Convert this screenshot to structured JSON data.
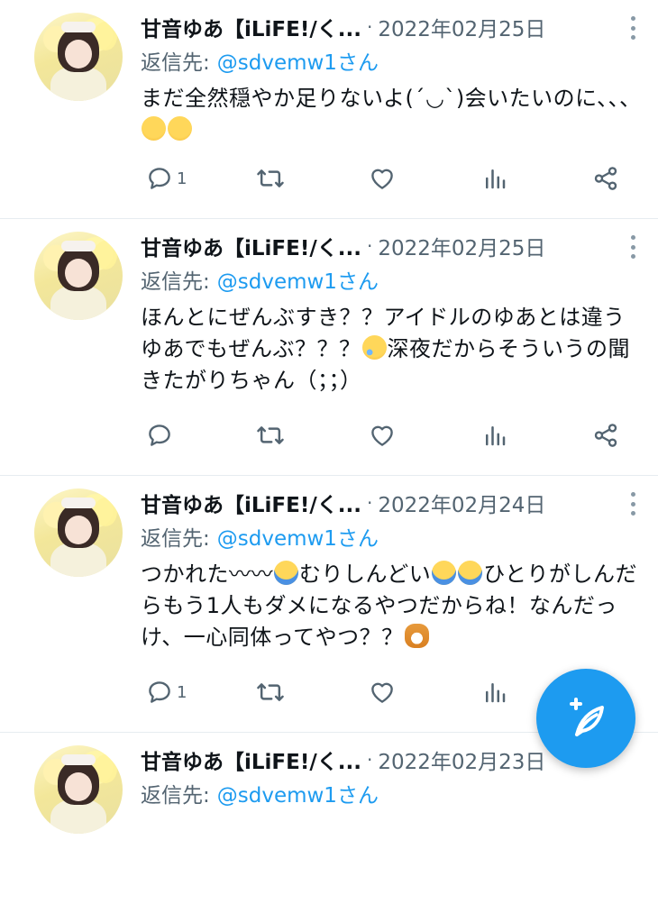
{
  "tweets": [
    {
      "name": "甘音ゆあ【iLiFE!/く...",
      "separator": "·",
      "date": "2022年02月25日",
      "reply_label": "返信先:",
      "reply_handle": "@sdvemw1さん",
      "text_parts": [
        "まだ全然穏やか足りないよ(´◡ˋ)会いたいのに、、、",
        ""
      ],
      "reply_count": "1",
      "emoji": [
        "pensive",
        "pensive"
      ]
    },
    {
      "name": "甘音ゆあ【iLiFE!/く...",
      "separator": "·",
      "date": "2022年02月25日",
      "reply_label": "返信先:",
      "reply_handle": "@sdvemw1さん",
      "text_parts": [
        "ほんとにぜんぶすき？？アイドルのゆあとは違うゆあでもぜんぶ？？？",
        "深夜だからそういうの聞きたがりちゃん（；；）"
      ],
      "reply_count": "",
      "emoji": [
        "tear"
      ]
    },
    {
      "name": "甘音ゆあ【iLiFE!/く...",
      "separator": "·",
      "date": "2022年02月24日",
      "reply_label": "返信先:",
      "reply_handle": "@sdvemw1さん",
      "text_parts": [
        "つかれた〰〰",
        "むりしんどい",
        "ひとりがしんだらもう1人もダメになるやつだからね！なんだっけ、一心同体ってやつ？？",
        ""
      ],
      "reply_count": "1",
      "emoji": [
        "crying",
        "crying",
        "crying",
        "dog"
      ]
    },
    {
      "name": "甘音ゆあ【iLiFE!/く...",
      "separator": "·",
      "date": "2022年02月23日",
      "reply_label": "返信先:",
      "reply_handle": "@sdvemw1さん"
    }
  ],
  "icons": {
    "reply": "reply-icon",
    "retweet": "retweet-icon",
    "like": "heart-icon",
    "analytics": "analytics-icon",
    "share": "share-icon",
    "more": "more-icon",
    "compose": "compose-icon"
  },
  "colors": {
    "accent": "#1d9bf0",
    "secondary_text": "#536471",
    "divider": "#e6ecf0"
  }
}
